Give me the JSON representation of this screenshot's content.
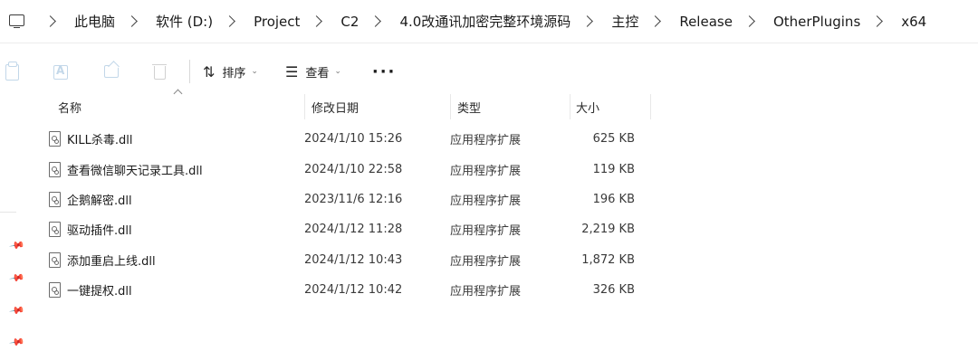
{
  "breadcrumb": [
    "此电脑",
    "软件 (D:)",
    "Project",
    "C2",
    "4.0改通讯加密完整环境源码",
    "主控",
    "Release",
    "OtherPlugins",
    "x64"
  ],
  "toolbar": {
    "sort_label": "排序",
    "view_label": "查看",
    "more_label": "···"
  },
  "columns": {
    "name": "名称",
    "date": "修改日期",
    "type": "类型",
    "size": "大小"
  },
  "files": [
    {
      "name": "KILL杀毒.dll",
      "date": "2024/1/10 15:26",
      "type": "应用程序扩展",
      "size": "625 KB"
    },
    {
      "name": "查看微信聊天记录工具.dll",
      "date": "2024/1/10 22:58",
      "type": "应用程序扩展",
      "size": "119 KB"
    },
    {
      "name": "企鹅解密.dll",
      "date": "2023/11/6 12:16",
      "type": "应用程序扩展",
      "size": "196 KB"
    },
    {
      "name": "驱动插件.dll",
      "date": "2024/1/12 11:28",
      "type": "应用程序扩展",
      "size": "2,219 KB"
    },
    {
      "name": "添加重启上线.dll",
      "date": "2024/1/12 10:43",
      "type": "应用程序扩展",
      "size": "1,872 KB"
    },
    {
      "name": "一键提权.dll",
      "date": "2024/1/12 10:42",
      "type": "应用程序扩展",
      "size": "326 KB"
    }
  ]
}
